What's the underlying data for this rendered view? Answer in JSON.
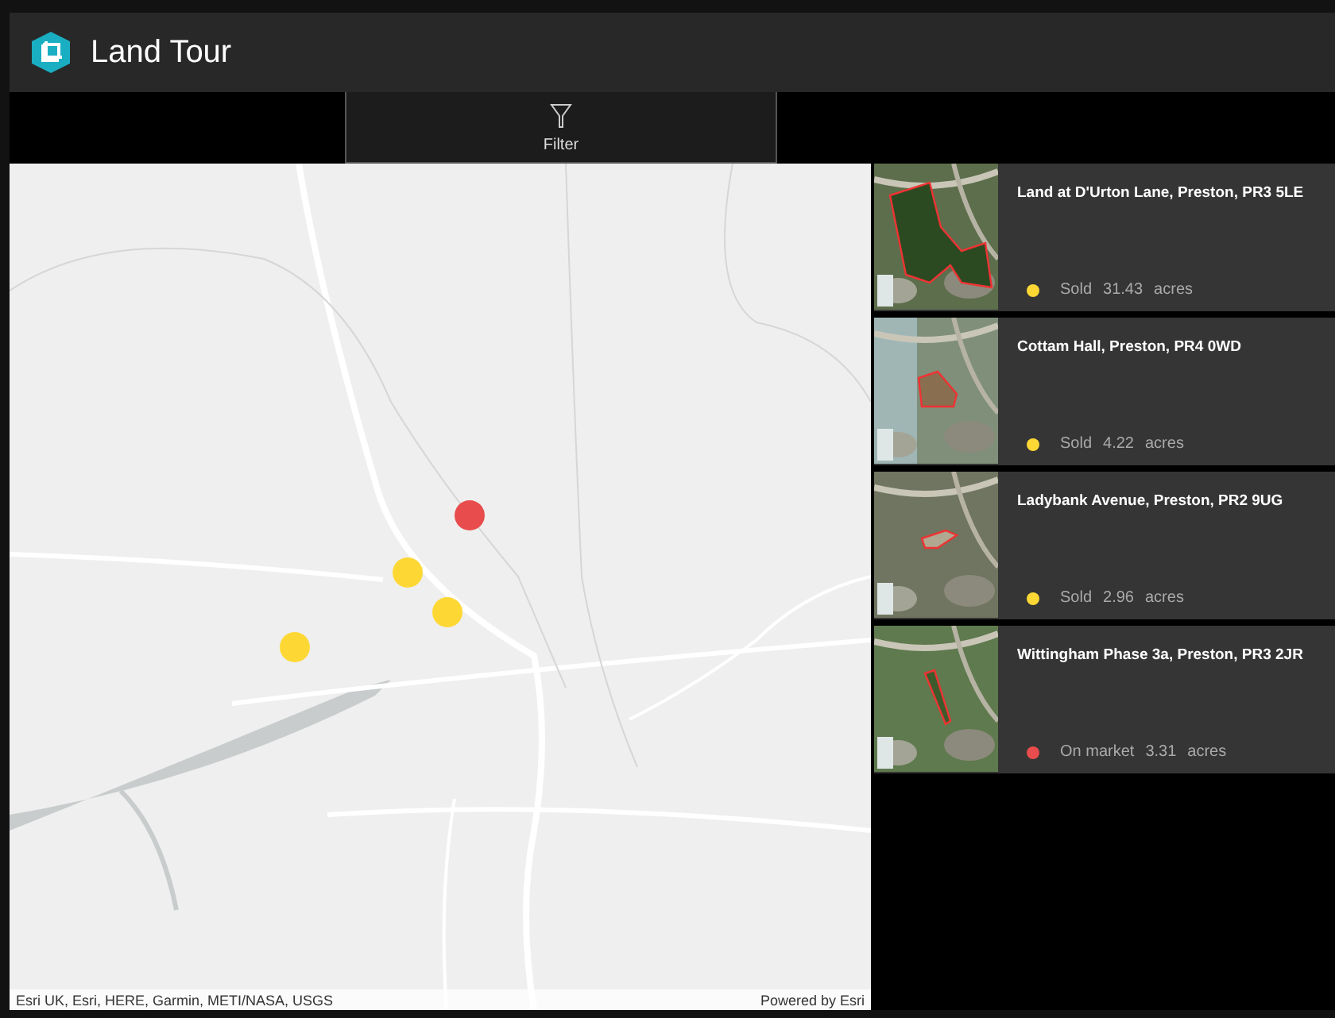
{
  "header": {
    "title": "Land Tour"
  },
  "toolbar": {
    "filter_button": {
      "label": "Filter"
    }
  },
  "map": {
    "markers": [
      {
        "color": "#e84c4c"
      },
      {
        "color": "#fdd835"
      },
      {
        "color": "#fdd835"
      },
      {
        "color": "#fdd835"
      }
    ],
    "attribution": "Esri UK, Esri, HERE, Garmin, METI/NASA, USGS",
    "powered_by": "Powered by Esri"
  },
  "sites": [
    {
      "title": "Land at D'Urton Lane, Preston, PR3 5LE",
      "status": "Sold",
      "color": "#fdd835",
      "acres": "31.43",
      "unit": "acres"
    },
    {
      "title": "Cottam Hall, Preston, PR4 0WD",
      "status": "Sold",
      "color": "#fdd835",
      "acres": "4.22",
      "unit": "acres"
    },
    {
      "title": "Ladybank Avenue, Preston, PR2 9UG",
      "status": "Sold",
      "color": "#fdd835",
      "acres": "2.96",
      "unit": "acres"
    },
    {
      "title": "Wittingham Phase 3a, Preston, PR3 2JR",
      "status": "On market",
      "color": "#e84c4c",
      "acres": "3.31",
      "unit": "acres"
    }
  ]
}
